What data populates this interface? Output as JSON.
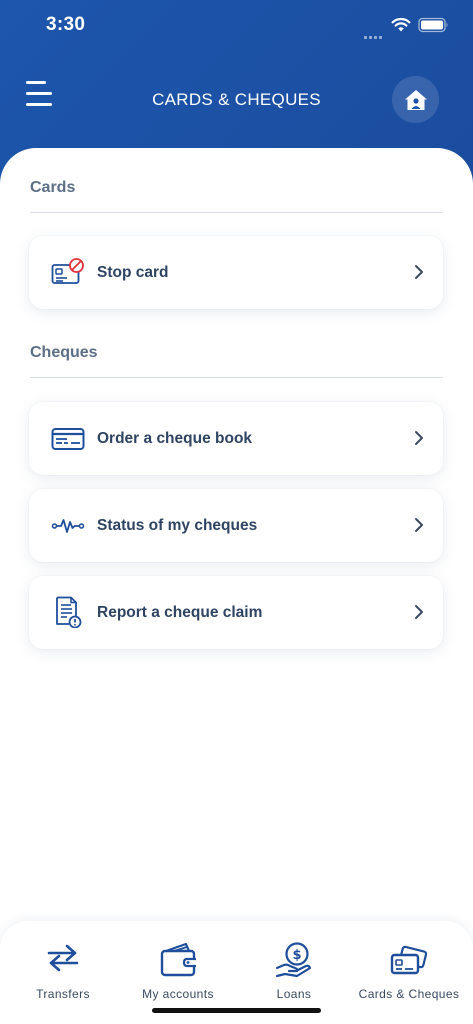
{
  "status_bar": {
    "time": "3:30"
  },
  "header": {
    "title": "CARDS & CHEQUES"
  },
  "sections": [
    {
      "title": "Cards"
    },
    {
      "title": "Cheques"
    }
  ],
  "items": [
    {
      "label": "Stop card",
      "icon": "stop-card-icon"
    },
    {
      "label": "Order a cheque book",
      "icon": "cheque-book-icon"
    },
    {
      "label": "Status of my cheques",
      "icon": "cheque-status-icon"
    },
    {
      "label": "Report a cheque claim",
      "icon": "cheque-claim-icon"
    }
  ],
  "nav": [
    {
      "label": "Transfers",
      "icon": "transfers-icon"
    },
    {
      "label": "My accounts",
      "icon": "wallet-icon"
    },
    {
      "label": "Loans",
      "icon": "loans-icon"
    },
    {
      "label": "Cards & Cheques",
      "icon": "cards-cheques-icon"
    }
  ],
  "colors": {
    "brand_blue": "#1a4a9a",
    "icon_blue": "#1f4f9c",
    "stop_red": "#e0313a",
    "text_dark": "#2f4463",
    "section_gray": "#5d6f87"
  }
}
